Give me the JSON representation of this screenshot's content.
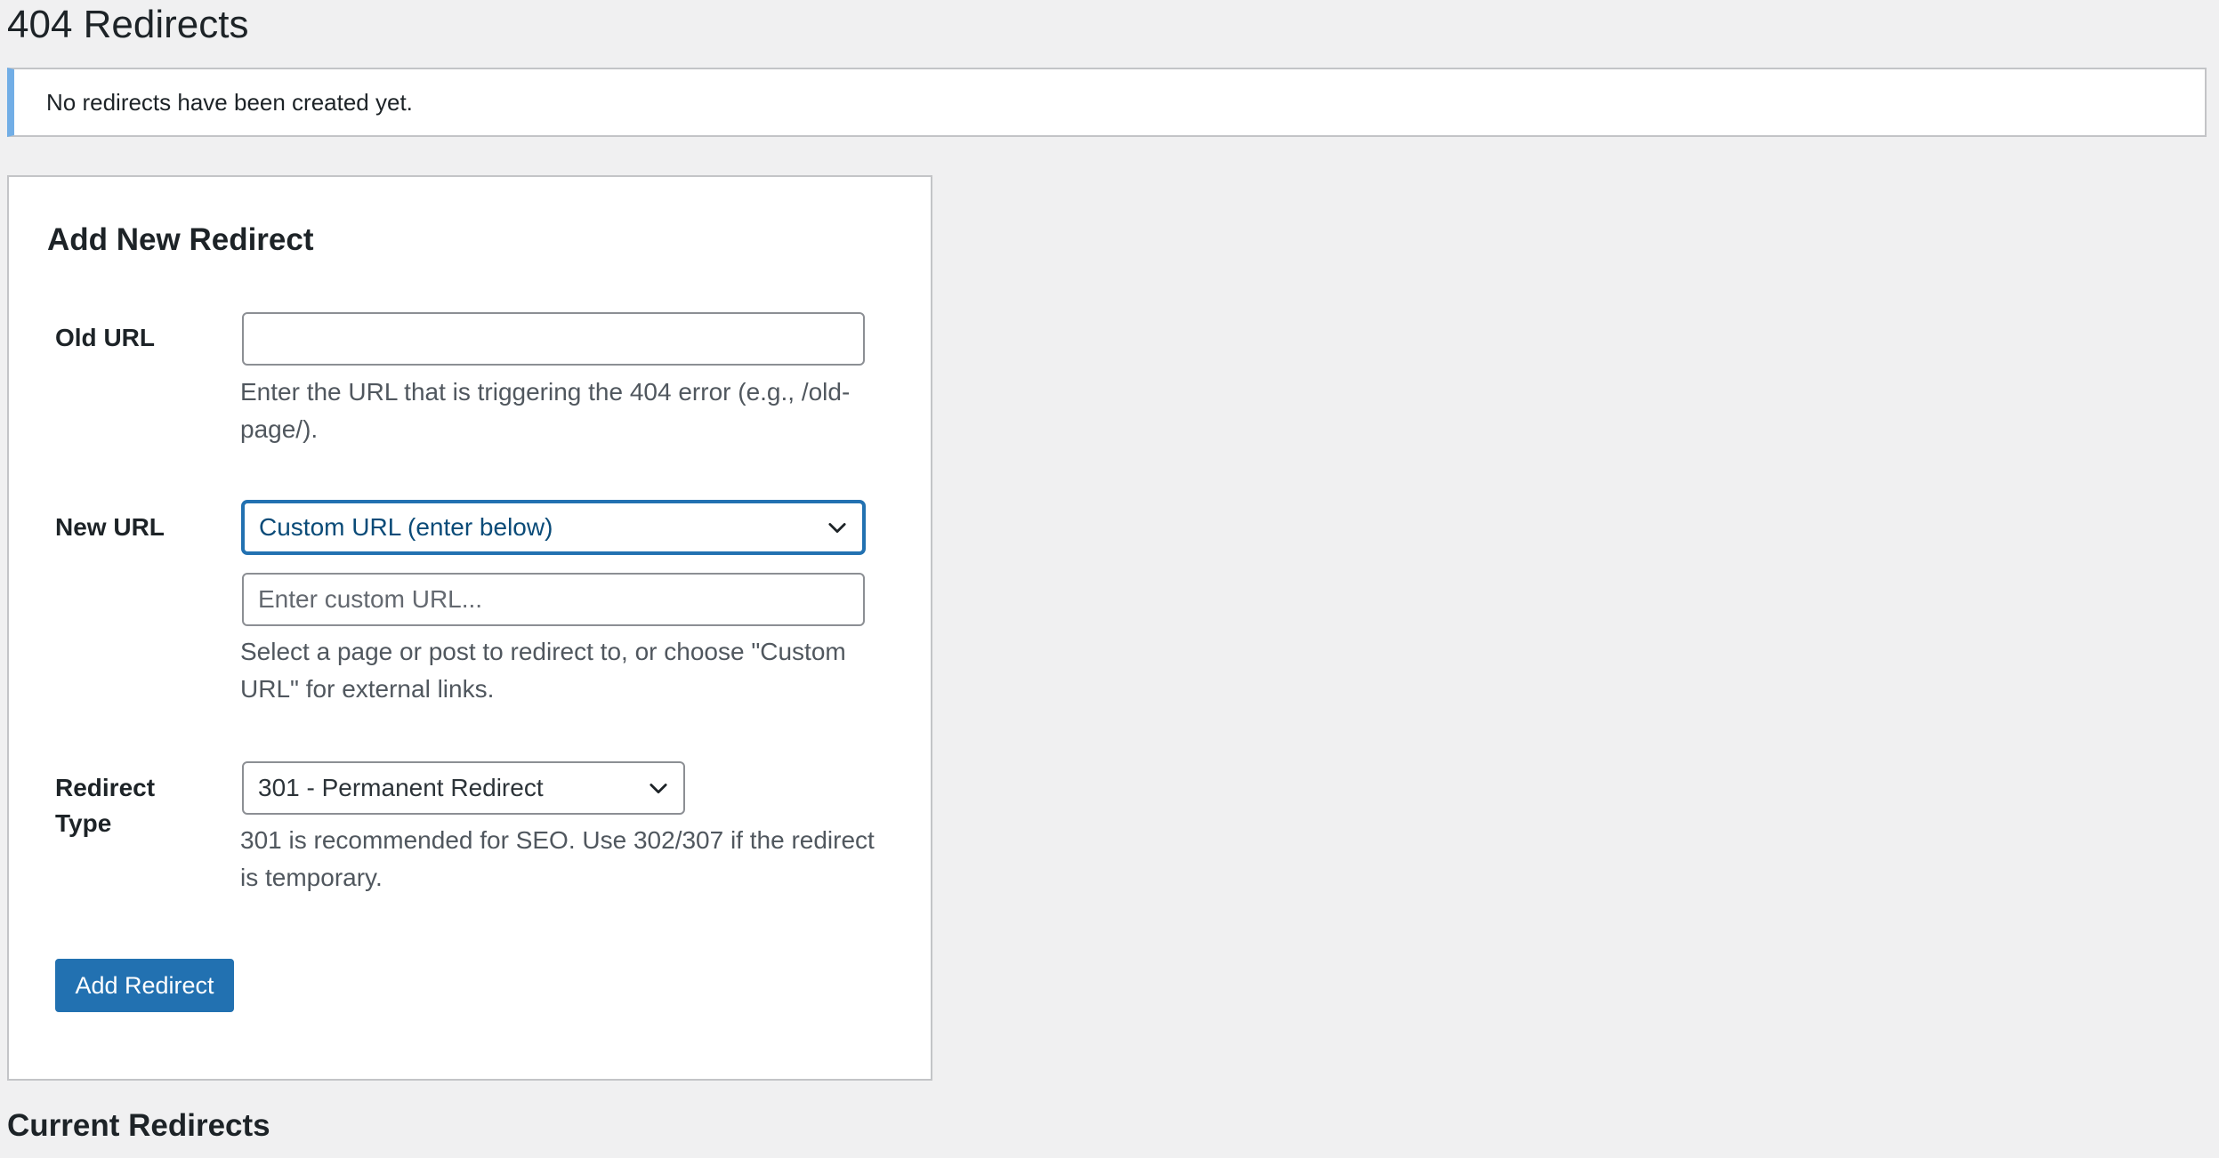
{
  "page": {
    "title": "404 Redirects"
  },
  "notice": {
    "message": "No redirects have been created yet."
  },
  "form": {
    "title": "Add New Redirect",
    "old_url": {
      "label": "Old URL",
      "value": "",
      "placeholder": "",
      "help": "Enter the URL that is triggering the 404 error (e.g., /old-page/)."
    },
    "new_url": {
      "label": "New URL",
      "selected": "Custom URL (enter below)",
      "custom_value": "",
      "custom_placeholder": "Enter custom URL...",
      "help": "Select a page or post to redirect to, or choose \"Custom URL\" for external links."
    },
    "redirect_type": {
      "label": "Redirect Type",
      "selected": "301 - Permanent Redirect",
      "help": "301 is recommended for SEO. Use 302/307 if the redirect is temporary."
    },
    "submit_label": "Add Redirect"
  },
  "current": {
    "title": "Current Redirects"
  },
  "icons": {
    "dropdown": "chevron-down-icon"
  },
  "colors": {
    "primary": "#2271b1",
    "notice_accent": "#72aee6",
    "background": "#f0f0f1",
    "border": "#c3c4c7"
  }
}
